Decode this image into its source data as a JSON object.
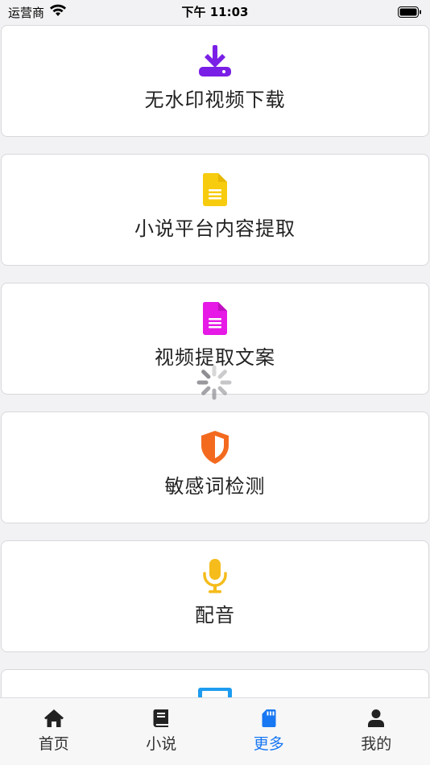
{
  "status_bar": {
    "carrier": "运营商",
    "time": "下午 11:03"
  },
  "cards": [
    {
      "label": "无水印视频下载",
      "icon": "download-icon",
      "color": "#7a1fe6"
    },
    {
      "label": "小说平台内容提取",
      "icon": "document-icon",
      "color": "#f7cc0f"
    },
    {
      "label": "视频提取文案",
      "icon": "document-icon",
      "color": "#e619e6"
    },
    {
      "label": "敏感词检测",
      "icon": "shield-icon",
      "color": "#f36a1f"
    },
    {
      "label": "配音",
      "icon": "microphone-icon",
      "color": "#f5bc1b"
    },
    {
      "label": "",
      "icon": "card-partial-icon",
      "color": "#1e9cf0"
    }
  ],
  "tab_bar": {
    "tabs": [
      {
        "label": "首页",
        "icon": "home-icon"
      },
      {
        "label": "小说",
        "icon": "book-icon"
      },
      {
        "label": "更多",
        "icon": "sd-card-icon",
        "active": true
      },
      {
        "label": "我的",
        "icon": "user-icon"
      }
    ],
    "active_color": "#1877f2"
  }
}
